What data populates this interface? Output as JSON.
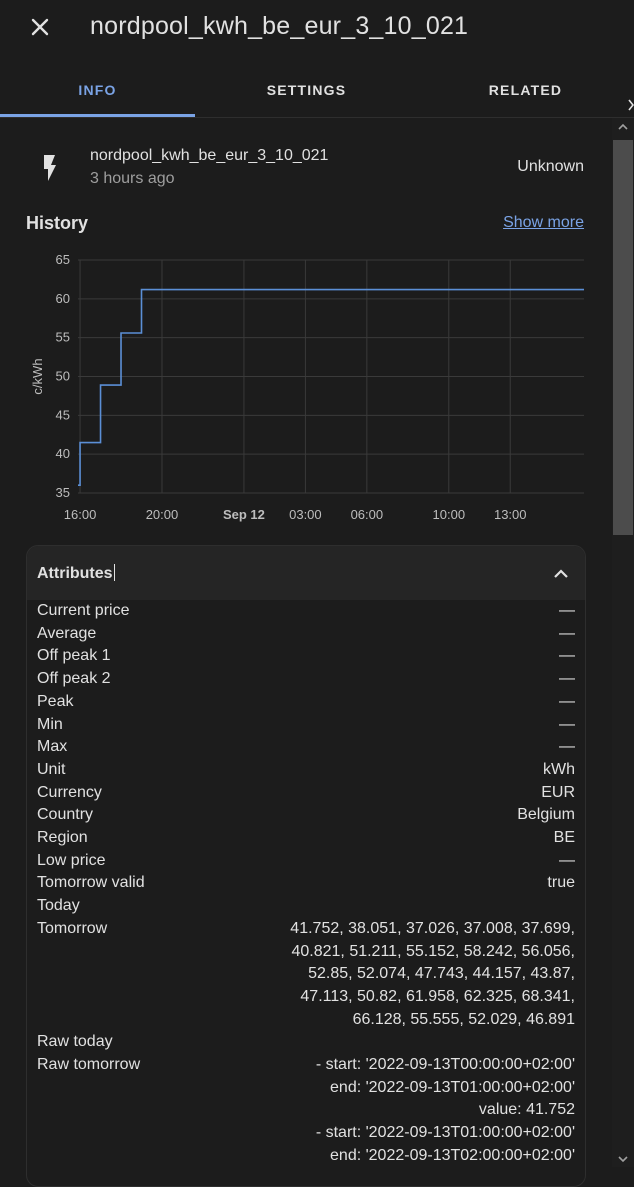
{
  "dialog": {
    "title": "nordpool_kwh_be_eur_3_10_021"
  },
  "tabs": [
    {
      "label": "INFO",
      "active": true
    },
    {
      "label": "SETTINGS",
      "active": false
    },
    {
      "label": "RELATED",
      "active": false
    }
  ],
  "entity": {
    "icon": "flash-icon",
    "name": "nordpool_kwh_be_eur_3_10_021",
    "last_changed": "3 hours ago",
    "state": "Unknown"
  },
  "history": {
    "title": "History",
    "show_more": "Show more"
  },
  "chart_data": {
    "type": "line",
    "title": "",
    "xlabel": "",
    "ylabel": "c/kWh",
    "ylim": [
      35,
      65
    ],
    "yticks": [
      "35",
      "40",
      "45",
      "50",
      "55",
      "60",
      "65"
    ],
    "xticks": [
      {
        "label": "16:00",
        "t": 16.0,
        "bold": false
      },
      {
        "label": "20:00",
        "t": 20.0,
        "bold": false
      },
      {
        "label": "Sep 12",
        "t": 24.0,
        "bold": true
      },
      {
        "label": "03:00",
        "t": 27.0,
        "bold": false
      },
      {
        "label": "06:00",
        "t": 30.0,
        "bold": false
      },
      {
        "label": "10:00",
        "t": 34.0,
        "bold": false
      },
      {
        "label": "13:00",
        "t": 37.0,
        "bold": false
      }
    ],
    "xlim": [
      15.9,
      40.6
    ],
    "grid": true,
    "line_color": "#5b8fd6",
    "series": [
      {
        "step": true,
        "x": [
          15.9,
          16.0,
          17.0,
          18.0,
          19.0,
          40.6
        ],
        "y": [
          36.0,
          41.5,
          48.9,
          55.6,
          61.2,
          61.2
        ]
      }
    ]
  },
  "attributes": {
    "title": "Attributes",
    "rows": [
      {
        "key": "Current price",
        "value": "—"
      },
      {
        "key": "Average",
        "value": "—"
      },
      {
        "key": "Off peak 1",
        "value": "—"
      },
      {
        "key": "Off peak 2",
        "value": "—"
      },
      {
        "key": "Peak",
        "value": "—"
      },
      {
        "key": "Min",
        "value": "—"
      },
      {
        "key": "Max",
        "value": "—"
      },
      {
        "key": "Unit",
        "value": "kWh"
      },
      {
        "key": "Currency",
        "value": "EUR"
      },
      {
        "key": "Country",
        "value": "Belgium"
      },
      {
        "key": "Region",
        "value": "BE"
      },
      {
        "key": "Low price",
        "value": "—"
      },
      {
        "key": "Tomorrow valid",
        "value": "true"
      },
      {
        "key": "Today",
        "value": ""
      },
      {
        "key": "Tomorrow",
        "value": "41.752, 38.051, 37.026, 37.008, 37.699,\n40.821, 51.211, 55.152, 58.242, 56.056,\n52.85, 52.074, 47.743, 44.157, 43.87,\n47.113, 50.82, 61.958, 62.325, 68.341,\n66.128, 55.555, 52.029, 46.891"
      },
      {
        "key": "Raw today",
        "value": ""
      },
      {
        "key": "Raw tomorrow",
        "value": "- start: '2022-09-13T00:00:00+02:00'\nend: '2022-09-13T01:00:00+02:00'\nvalue: 41.752\n- start: '2022-09-13T01:00:00+02:00'\nend: '2022-09-13T02:00:00+02:00'"
      }
    ]
  }
}
